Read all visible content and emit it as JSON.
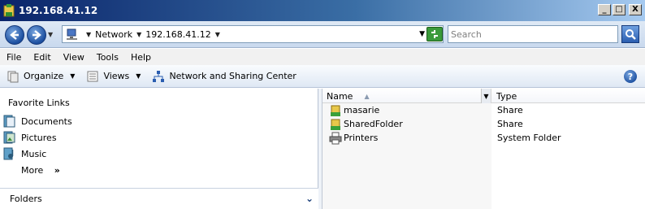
{
  "window": {
    "title": "192.168.41.12",
    "minimize": "_",
    "maximize": "□",
    "close": "X"
  },
  "address": {
    "segments": [
      "Network",
      "192.168.41.12"
    ],
    "search_placeholder": "Search"
  },
  "menu": [
    "File",
    "Edit",
    "View",
    "Tools",
    "Help"
  ],
  "commands": {
    "organize": "Organize",
    "views": "Views",
    "network_center": "Network and Sharing Center"
  },
  "nav": {
    "favorites_title": "Favorite Links",
    "items": [
      "Documents",
      "Pictures",
      "Music"
    ],
    "more": "More",
    "more_chevron": "»",
    "folders": "Folders"
  },
  "list": {
    "columns": {
      "name": "Name",
      "type": "Type"
    },
    "rows": [
      {
        "name": "masarie",
        "type": "Share",
        "icon": "shared-folder-icon"
      },
      {
        "name": "SharedFolder",
        "type": "Share",
        "icon": "shared-folder-icon"
      },
      {
        "name": "Printers",
        "type": "System Folder",
        "icon": "printer-icon"
      }
    ]
  },
  "colors": {
    "titlebar_start": "#0a246a",
    "titlebar_end": "#a6caf0",
    "accent": "#1c4fa0"
  }
}
